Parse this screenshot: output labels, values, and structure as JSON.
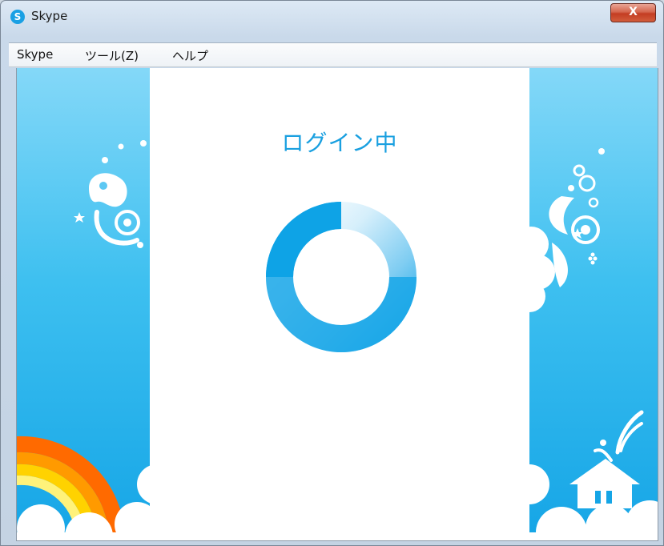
{
  "window": {
    "title": "Skype",
    "close_label": "X",
    "app_icon": "S"
  },
  "menu": {
    "items": [
      "Skype",
      "ツール(Z)",
      "ヘルプ"
    ]
  },
  "login": {
    "status_text": "ログイン中"
  },
  "colors": {
    "brand": "#00aff0",
    "sky_top": "#84d8f8",
    "sky_bottom": "#15a5e6"
  },
  "icons": [
    "skype-logo-icon",
    "close-icon",
    "loading-spinner-icon",
    "rainbow-icon",
    "house-icon"
  ]
}
